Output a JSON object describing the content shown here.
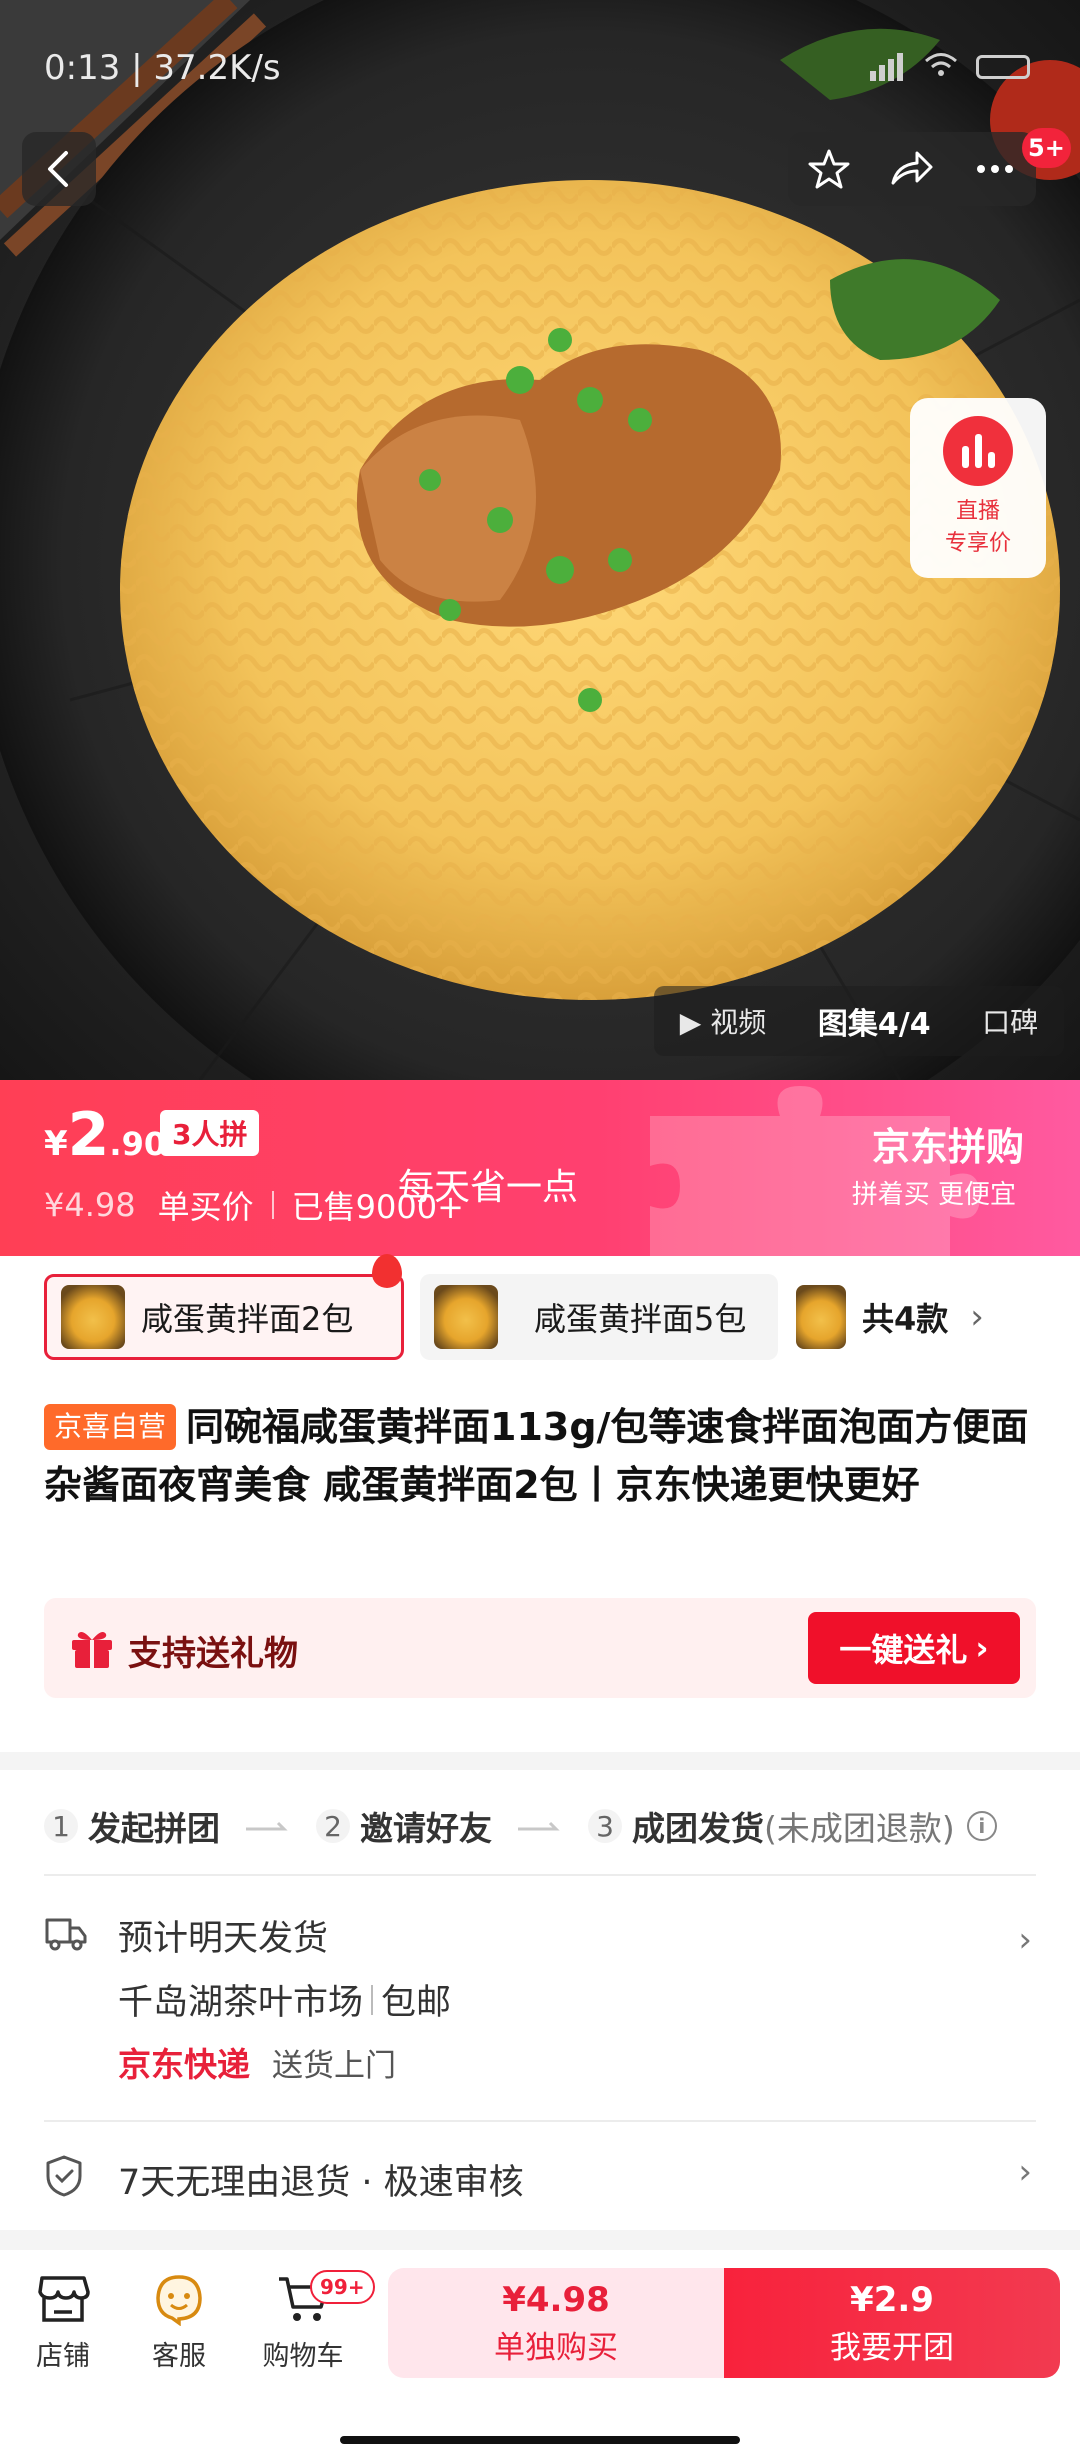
{
  "status_bar": {
    "time_speed": "0:13 | 37.2K/s"
  },
  "top_nav": {
    "badge": "5+"
  },
  "hero": {
    "live": {
      "line1": "直播",
      "line2": "专享价"
    },
    "media_tabs": {
      "video": "视频",
      "gallery": "图集4/4",
      "reviews": "口碑"
    }
  },
  "price_banner": {
    "yen": "¥",
    "price_int": "2",
    "price_dec": ".90",
    "group_tag": "3人拼",
    "original_price": "¥4.98",
    "single_label": "单买价",
    "sold": "已售9000+",
    "slogan": "每天省一点",
    "brand_title": "京东拼购",
    "brand_sub": "拼着买 更便宜"
  },
  "variants": {
    "items": [
      "咸蛋黄拌面2包",
      "咸蛋黄拌面5包"
    ],
    "total": "共4款"
  },
  "product": {
    "self_tag": "京喜自营",
    "title": "同碗福咸蛋黄拌面113g/包等速食拌面泡面方便面杂酱面夜宵美食 咸蛋黄拌面2包丨京东快递更快更好"
  },
  "gift": {
    "label": "支持送礼物",
    "button": "一键送礼"
  },
  "steps": {
    "n1": "1",
    "s1": "发起拼团",
    "n2": "2",
    "s2": "邀请好友",
    "n3": "3",
    "s3": "成团发货",
    "note": "(未成团退款)"
  },
  "delivery": {
    "eta": "预计明天发货",
    "origin": "千岛湖茶叶市场",
    "shipping": "包邮",
    "carrier": "京东快递",
    "service": "送货上门"
  },
  "returns": {
    "text": "7天无理由退货 · 极速审核"
  },
  "bottom_bar": {
    "store": "店铺",
    "service": "客服",
    "cart": "购物车",
    "cart_badge": "99+",
    "single_price": "¥4.98",
    "single_label": "单独购买",
    "group_price": "¥2.9",
    "group_label": "我要开团"
  },
  "colors": {
    "accent_red": "#f0102a",
    "banner_pink": "#ff4070",
    "tag_orange": "#ff6a2a"
  }
}
